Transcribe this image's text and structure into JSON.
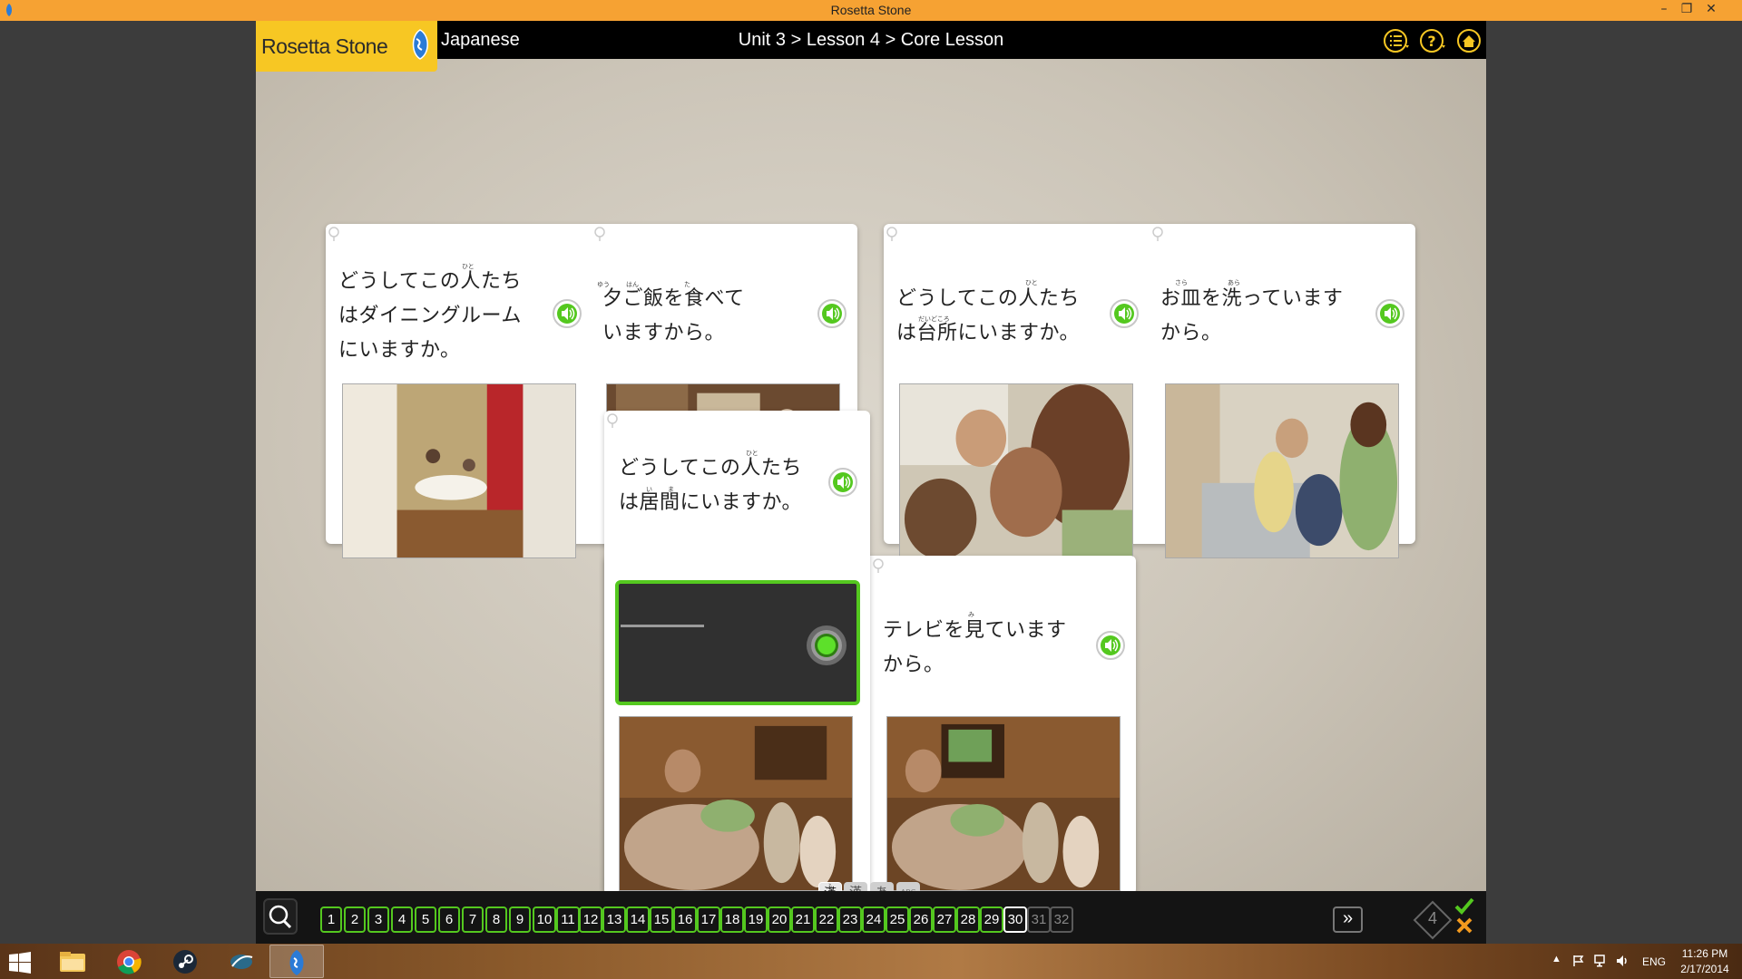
{
  "window": {
    "title": "Rosetta Stone",
    "controls": [
      "minimize-icon",
      "restore-icon",
      "close-icon"
    ]
  },
  "app": {
    "logo_text": "Rosetta Stone",
    "language": "Japanese",
    "breadcrumb": "Unit 3 > Lesson 4 > Core Lesson",
    "header_icons": [
      "list-menu-icon",
      "help-icon",
      "home-icon"
    ]
  },
  "cards": {
    "c1": {
      "text_line1": "どうしてこの人たち",
      "text_line2": "はダイニングルーム",
      "text_line3": "にいますか。",
      "furigana": "ひと"
    },
    "c2": {
      "text_line1": "夕ご飯を食べて",
      "text_line2": "いますから。",
      "furigana1": "ゆう",
      "furigana2": "はん",
      "furigana3": "た"
    },
    "c3": {
      "text_line1": "どうしてこの人たち",
      "text_line2": "は台所にいますか。",
      "furigana1": "ひと",
      "furigana2": "だいどころ"
    },
    "c4": {
      "text_line1": "お皿を洗っています",
      "text_line2": "から。",
      "furigana1": "さら",
      "furigana2": "あら"
    },
    "c5": {
      "text_line1": "どうしてこの人たち",
      "text_line2": "は居間にいますか。",
      "furigana1": "ひと",
      "furigana2": "い",
      "furigana3": "ま"
    },
    "c6": {
      "text_line1": "テレビを見ています",
      "text_line2": "から。",
      "furigana1": "み"
    }
  },
  "script_toggle": {
    "options": [
      "漢",
      "漢",
      "あ",
      "ABC"
    ],
    "small_label": "ふ"
  },
  "progress": {
    "screens": [
      "1",
      "2",
      "3",
      "4",
      "5",
      "6",
      "7",
      "8",
      "9",
      "10",
      "11",
      "12",
      "13",
      "14",
      "15",
      "16",
      "17",
      "18",
      "19",
      "20",
      "21",
      "22",
      "23",
      "24",
      "25",
      "26",
      "27",
      "28",
      "29",
      "30",
      "31",
      "32"
    ],
    "current": 30,
    "completed_through": 29,
    "next_label": "»",
    "lesson_number": "4"
  },
  "taskbar": {
    "apps": [
      "windows-start-icon",
      "file-explorer-icon",
      "chrome-icon",
      "steam-icon",
      "app-icon",
      "rosetta-stone-icon"
    ],
    "language": "ENG",
    "time": "11:26 PM",
    "date": "2/17/2014"
  },
  "colors": {
    "titlebar": "#f6a233",
    "logo": "#f7c723",
    "accent_green": "#54c81f",
    "header_bg": "#000000"
  }
}
